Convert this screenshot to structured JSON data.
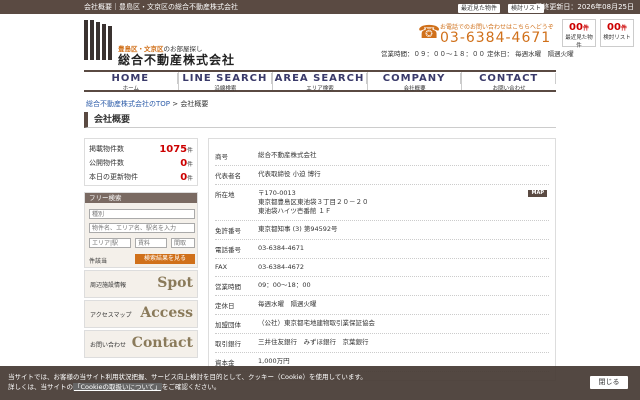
{
  "topbar": {
    "left": "会社概要｜豊島区・文京区の総合不動産株式会社",
    "right": "最終更新日：2026年08月25日",
    "recent_label": "最近見た物件",
    "saved_label": "検討リスト"
  },
  "logo": {
    "sub_hl": "豊島区・文京区",
    "sub_rest": "のお部屋探し",
    "name": "総合不動産株式会社"
  },
  "contact": {
    "note": "お電話でのお問い合わせはこちらへどうぞ",
    "phone": "03-6384-4671",
    "hours": "営業時間：０９：００〜１８：００ 定休日： 毎週水曜　隔週火曜"
  },
  "counters": [
    {
      "num": "00",
      "unit": "件",
      "label": "最近見た物件"
    },
    {
      "num": "00",
      "unit": "件",
      "label": "検討リスト"
    }
  ],
  "nav": [
    {
      "en": "HOME",
      "jp": "ホーム"
    },
    {
      "en": "LINE SEARCH",
      "jp": "沿線検索"
    },
    {
      "en": "AREA SEARCH",
      "jp": "エリア検索"
    },
    {
      "en": "COMPANY",
      "jp": "会社概要"
    },
    {
      "en": "CONTACT",
      "jp": "お問い合わせ"
    }
  ],
  "breadcrumb": {
    "home": "総合不動産株式会社のTOP",
    "sep": ">",
    "current": "会社概要"
  },
  "page_title": "会社概要",
  "stats": [
    {
      "label": "掲載物件数",
      "num": "1075",
      "unit": "件"
    },
    {
      "label": "公開物件数",
      "num": "0",
      "unit": "件"
    },
    {
      "label": "本日の更新物件",
      "num": "0",
      "unit": "件"
    }
  ],
  "search": {
    "header": "フリー検索",
    "type_placeholder": "種別",
    "keyword_placeholder": "物件名、エリア名、駅名を入力",
    "area_placeholder": "エリア|駅",
    "rent_placeholder": "賃料",
    "layout_placeholder": "間取",
    "count_label": "件該当",
    "submit": "検索結果を見る"
  },
  "side_banners": [
    {
      "small": "周辺施設情報",
      "big": "Spot"
    },
    {
      "small": "アクセスマップ",
      "big": "Access"
    },
    {
      "small": "お問い合わせ",
      "big": "Contact"
    }
  ],
  "company": {
    "map_label": "MAP",
    "rows": [
      {
        "k": "商号",
        "v": "総合不動産株式会社"
      },
      {
        "k": "代表者名",
        "v": "代表取締役 小迫 博行"
      },
      {
        "k": "所在地",
        "v": "〒170-0013\n東京都豊島区東池袋３丁目２０－２０\n東池袋ハイツ壱番館 １Ｆ"
      },
      {
        "k": "免許番号",
        "v": "東京都知事 (3) 第94592号"
      },
      {
        "k": "電話番号",
        "v": "03-6384-4671"
      },
      {
        "k": "FAX",
        "v": "03-6384-4672"
      },
      {
        "k": "営業時間",
        "v": "09：00〜18：00"
      },
      {
        "k": "定休日",
        "v": "毎週水曜　隔週火曜"
      },
      {
        "k": "加盟団体",
        "v": "（公社）東京都宅地建物取引業保証協会"
      },
      {
        "k": "取引銀行",
        "v": "三井住友銀行　みずほ銀行　京葉銀行"
      },
      {
        "k": "資本金",
        "v": "1,000万円"
      }
    ]
  },
  "cookie": {
    "line1": "当サイトでは、お客様の当サイト利用状況把握、サービス向上検討を目的として、クッキー（Cookie）を使用しています。",
    "line2_pre": "詳しくは、当サイトの",
    "link": "「Cookieの取扱いについて」",
    "line2_post": "をご確認ください。",
    "close": "閉じる"
  }
}
